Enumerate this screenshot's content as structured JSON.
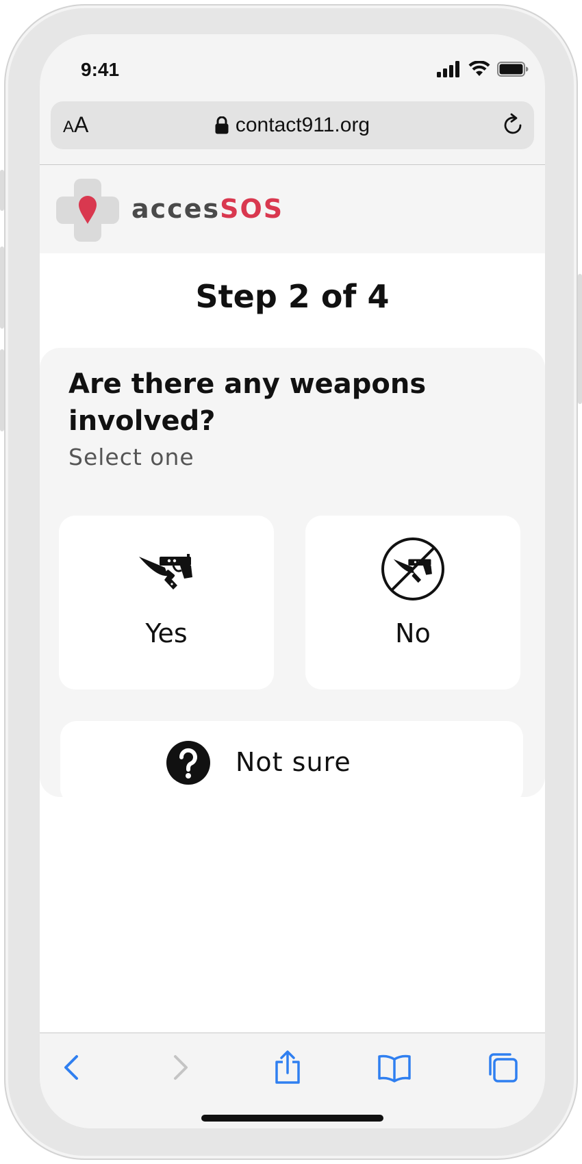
{
  "status_bar": {
    "time": "9:41"
  },
  "url_bar": {
    "text_size_small": "A",
    "text_size_large": "A",
    "url": "contact911.org",
    "icons": {
      "lock": "lock-icon",
      "reload": "reload-icon"
    }
  },
  "site": {
    "brand_part1": "acces",
    "brand_part2": "SOS",
    "brand_colors": {
      "gray": "#4a4a4a",
      "red": "#d9384f"
    }
  },
  "step": {
    "title": "Step 2 of 4"
  },
  "question": {
    "title": "Are there any weapons involved?",
    "subtitle": "Select one",
    "options": [
      {
        "label": "Yes",
        "icon": "weapons-icon"
      },
      {
        "label": "No",
        "icon": "no-weapons-icon"
      },
      {
        "label": "Not sure",
        "icon": "question-mark-icon"
      }
    ]
  },
  "toolbar": {
    "icons": [
      "back-icon",
      "forward-icon",
      "share-icon",
      "bookmarks-icon",
      "tabs-icon"
    ],
    "accent_color": "#2f7ff0",
    "disabled_color": "#c4c4c4"
  }
}
